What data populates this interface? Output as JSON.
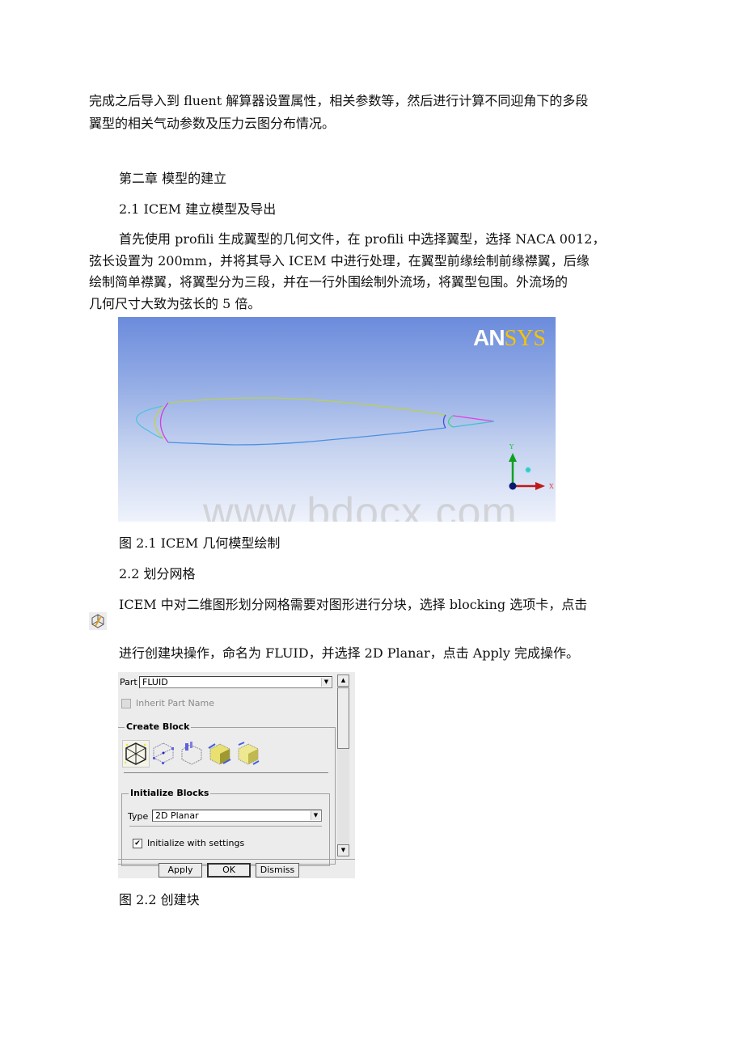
{
  "paragraphs": {
    "intro_line1": "完成之后导入到 fluent 解算器设置属性，相关参数等，然后进行计算不同迎角下的多段",
    "intro_line2": "翼型的相关气动参数及压力云图分布情况。",
    "chapter_title": "第二章 模型的建立",
    "section_2_1": "2.1 ICEM 建立模型及导出",
    "p2_line1": "首先使用 profili 生成翼型的几何文件，在 profili 中选择翼型，选择 NACA 0012，",
    "p2_line2": "弦长设置为 200mm，并将其导入 ICEM 中进行处理，在翼型前缘绘制前缘襟翼，后缘",
    "p2_line3": "绘制简单襟翼，将翼型分为三段，并在一行外围绘制外流场，将翼型包围。外流场的",
    "p2_line4": "几何尺寸大致为弦长的 5 倍。",
    "fig1_caption": "图 2.1  ICEM 几何模型绘制",
    "section_2_2": "2.2 划分网格",
    "p3_line1": "ICEM 中对二维图形划分网格需要对图形进行分块，选择 blocking 选项卡，点击",
    "p3_line2": "进行创建块操作，命名为 FLUID，并选择 2D Planar，点击 Apply 完成操作。",
    "fig2_caption": "图 2.2 创建块"
  },
  "figure1": {
    "logo_part1": "AN",
    "logo_part2": "SYS",
    "axis_x_label": "X",
    "axis_y_label": "Y",
    "watermark": "www.bdocx.com",
    "colors": {
      "leading_flap": "#4fc3e0",
      "leading_split": "#c8d048",
      "main_le": "#d040d8",
      "upper_surface": "#b8d050",
      "lower_surface": "#4a90e0",
      "trailing_main": "#4050e0",
      "trailing_flap_nose": "#40d080",
      "flap_upper": "#e040e0",
      "flap_lower": "#40c0d0"
    }
  },
  "inline_icon": "create-block-icon",
  "icem_panel": {
    "part_label": "Part",
    "part_value": "FLUID",
    "inherit_label": "Inherit Part Name",
    "inherit_checked": false,
    "create_block_title": "Create Block",
    "block_type_icons": [
      "initialize-block-icon",
      "from-vertices-icon",
      "extrude-faces-icon",
      "2d-to-3d-icon",
      "3d-to-2d-icon"
    ],
    "initialize_title": "Initialize Blocks",
    "type_label": "Type",
    "type_value": "2D Planar",
    "init_settings_label": "Initialize with settings",
    "init_settings_checked": true,
    "buttons": {
      "apply": "Apply",
      "ok": "OK",
      "dismiss": "Dismiss"
    }
  }
}
